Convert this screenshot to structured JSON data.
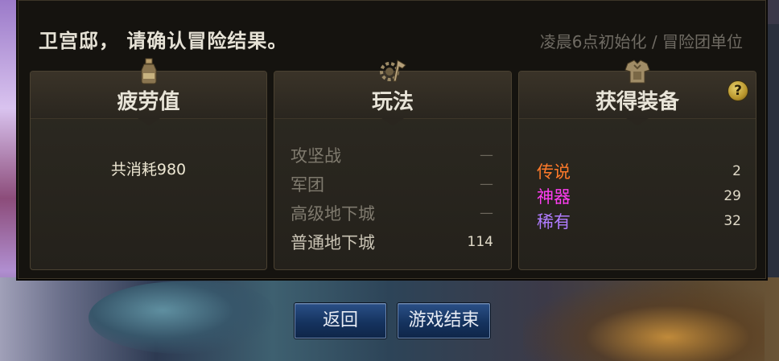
{
  "header": {
    "title": "卫宫邸，  请确认冒险结果。",
    "subtitle": "凌晨6点初始化 / 冒险团单位"
  },
  "fatigue_panel": {
    "title": "疲劳值",
    "icon": "potion-bottle-icon",
    "summary": "共消耗980"
  },
  "mode_panel": {
    "title": "玩法",
    "icon": "gear-axe-icon",
    "rows": [
      {
        "name": "攻坚战",
        "value": "—"
      },
      {
        "name": "军团",
        "value": "—"
      },
      {
        "name": "高级地下城",
        "value": "—"
      },
      {
        "name": "普通地下城",
        "value": "114"
      }
    ]
  },
  "gear_panel": {
    "title": "获得装备",
    "icon": "armor-icon",
    "help": "?",
    "rows": [
      {
        "name": "传说",
        "value": "2",
        "color": "#ff7a2a"
      },
      {
        "name": "神器",
        "value": "29",
        "color": "#ff3df2"
      },
      {
        "name": "稀有",
        "value": "32",
        "color": "#b07cff"
      }
    ]
  },
  "buttons": {
    "back": "返回",
    "end": "游戏结束"
  }
}
